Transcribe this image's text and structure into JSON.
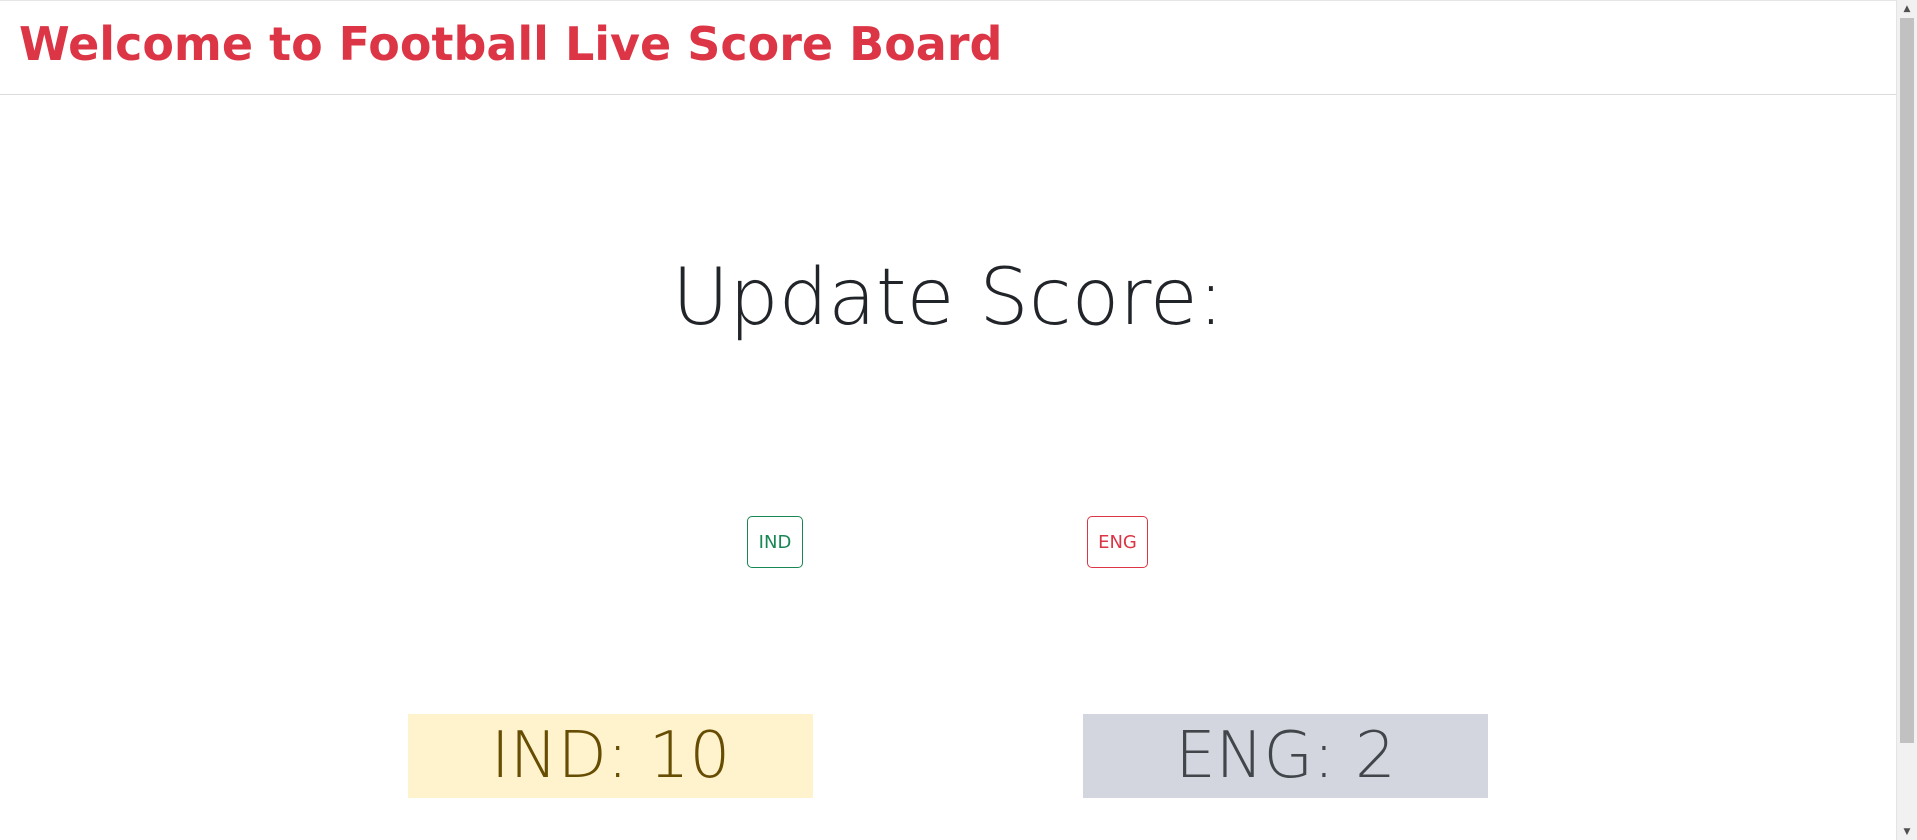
{
  "header": {
    "title": "Welcome to Football Live Score Board"
  },
  "main": {
    "heading": "Update Score:",
    "buttons": {
      "ind_label": "IND",
      "eng_label": "ENG"
    },
    "scores": {
      "ind_text": "IND: 10",
      "eng_text": "ENG: 2"
    }
  },
  "scrollbar": {
    "up_icon": "▲",
    "down_icon": "▼"
  },
  "colors": {
    "brand": "#dc3545",
    "ind_button": "#198754",
    "eng_button": "#dc3545",
    "ind_score_bg": "#fff3cd",
    "eng_score_bg": "#d3d6de"
  }
}
